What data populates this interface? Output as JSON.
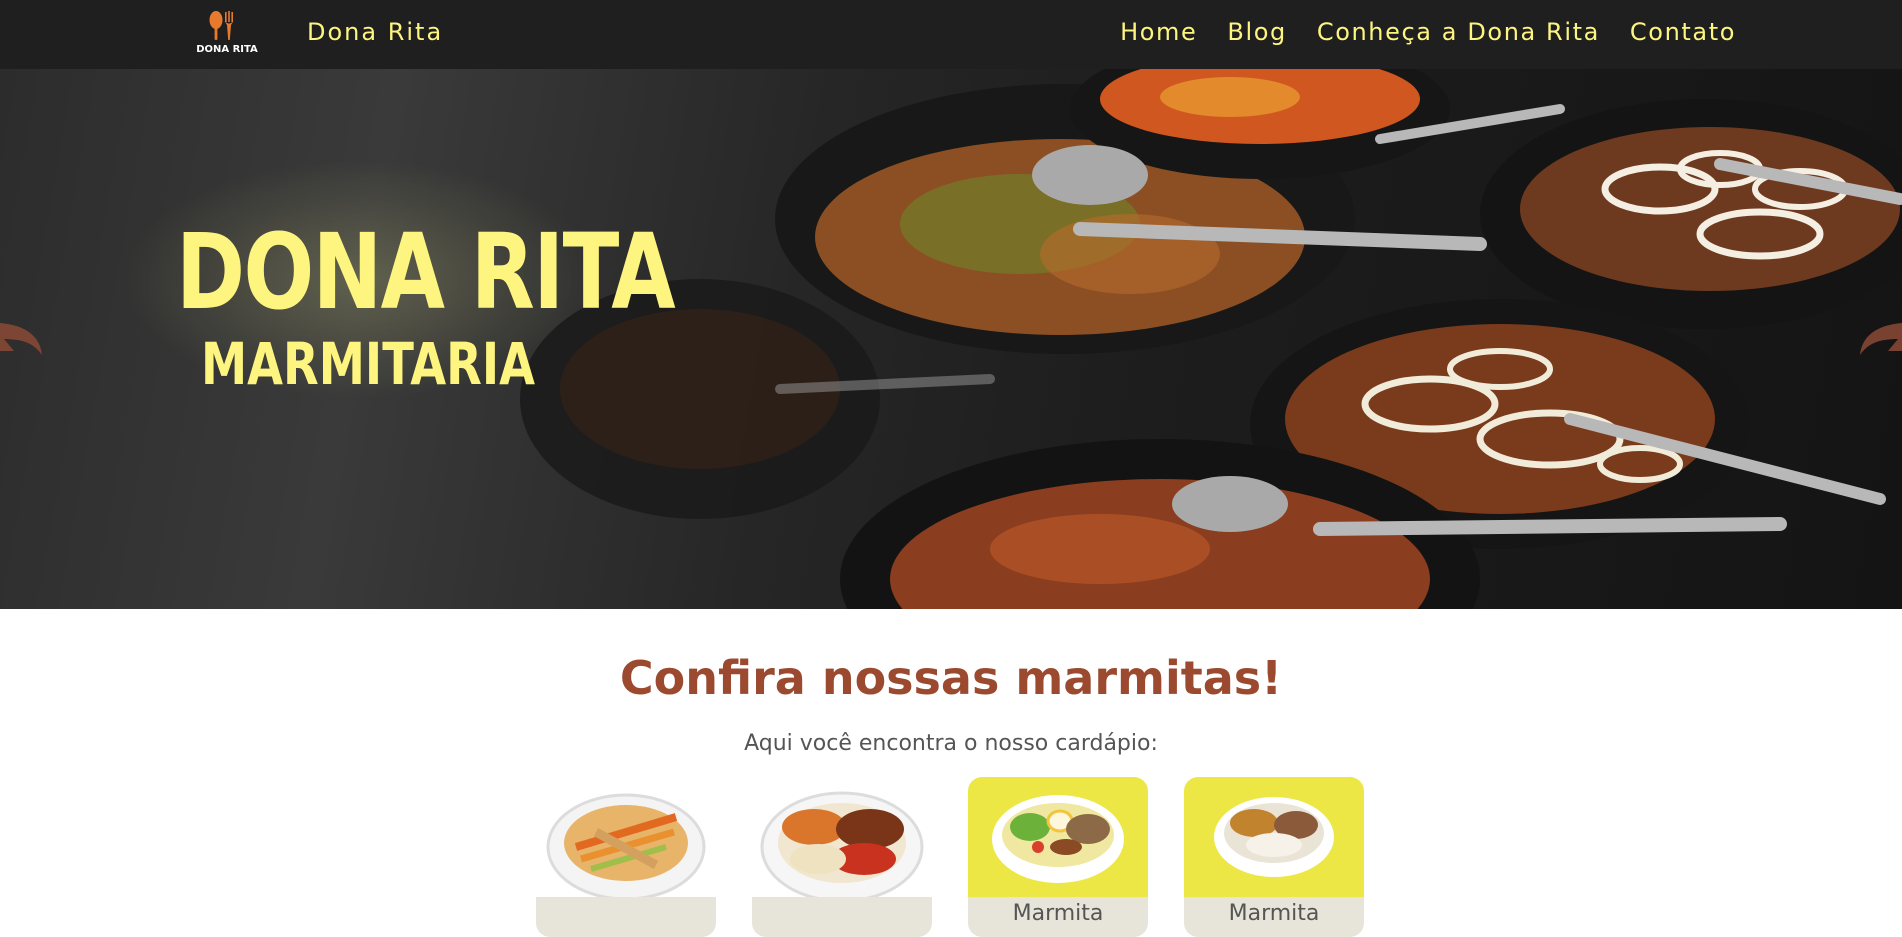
{
  "navbar": {
    "logo_text": "DONA RITA",
    "brand": "Dona Rita",
    "links": [
      "Home",
      "Blog",
      "Conheça a Dona Rita",
      "Contato"
    ]
  },
  "hero": {
    "title_line1": "DONA RITA",
    "title_line2": "MARMITARIA"
  },
  "menu_section": {
    "title": "Confira nossas marmitas!",
    "subtitle": "Aqui você encontra o nosso cardápio:",
    "cards": [
      {
        "caption": ""
      },
      {
        "caption": ""
      },
      {
        "caption": "Marmita"
      },
      {
        "caption": "Marmita"
      }
    ]
  },
  "colors": {
    "navbar_bg": "#1f1f1f",
    "nav_text": "#fdf57f",
    "section_title": "#9b4a2f",
    "card_yellow": "#ece745",
    "card_caption_bg": "#e7e5d9"
  }
}
